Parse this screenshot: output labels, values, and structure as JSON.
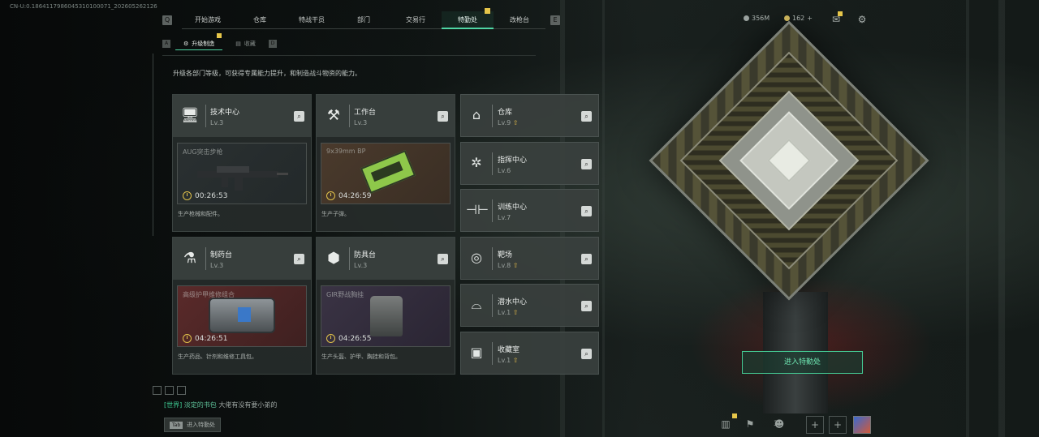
{
  "build_id": "CN-U:0.1864117986045310100071_202605262126",
  "nav": {
    "tabs": [
      "开始游戏",
      "仓库",
      "特战干员",
      "部门",
      "交易行",
      "特勤处",
      "改枪台"
    ],
    "active": "特勤处",
    "left_key": "Q",
    "right_key": "E"
  },
  "currency": {
    "primary": "356M",
    "secondary": "162"
  },
  "subtabs": [
    {
      "label": "升级制造",
      "active": true
    },
    {
      "label": "收藏",
      "active": false
    }
  ],
  "subtab_left_key": "A",
  "subtab_right_key": "D",
  "description": "升级各部门等级，可获得专属能力提升，和制造战斗物资的能力。",
  "production_stations": [
    {
      "name": "技术中心",
      "level": "Lv.3",
      "icon": "computer-icon",
      "item": "AUG突击步枪",
      "timer": "00:26:53",
      "footer": "生产枪械和配件。",
      "bg": "gray"
    },
    {
      "name": "工作台",
      "level": "Lv.3",
      "icon": "tools-icon",
      "item": "9x39mm BP",
      "timer": "04:26:59",
      "footer": "生产子弹。",
      "bg": "brown"
    },
    {
      "name": "制药台",
      "level": "Lv.3",
      "icon": "flask-icon",
      "item": "高级护甲维修组合",
      "timer": "04:26:51",
      "footer": "生产药品、针剂和维修工具包。",
      "bg": "red"
    },
    {
      "name": "防具台",
      "level": "Lv.3",
      "icon": "armor-icon",
      "item": "GIR野战胸挂",
      "timer": "04:26:55",
      "footer": "生产头盔、护甲、胸挂和背包。",
      "bg": "purple"
    }
  ],
  "departments": [
    {
      "name": "仓库",
      "level": "Lv.9",
      "icon": "warehouse-icon",
      "upgrade": true
    },
    {
      "name": "指挥中心",
      "level": "Lv.6",
      "icon": "chip-icon",
      "upgrade": false
    },
    {
      "name": "训练中心",
      "level": "Lv.7",
      "icon": "dumbbell-icon",
      "upgrade": false
    },
    {
      "name": "靶场",
      "level": "Lv.8",
      "icon": "target-icon",
      "upgrade": true
    },
    {
      "name": "潜水中心",
      "level": "Lv.1",
      "icon": "diving-icon",
      "upgrade": true
    },
    {
      "name": "收藏室",
      "level": "Lv.1",
      "icon": "collection-icon",
      "upgrade": true
    }
  ],
  "enter_button": "进入特勤处",
  "chat": {
    "channel": "[世界]",
    "user": "淡定的书包",
    "message": "大佬有没有要小弟的"
  },
  "tab_hint": {
    "key": "Tab",
    "label": "进入特勤处"
  },
  "party_count": "3",
  "colors": {
    "accent": "#4fd6a4",
    "badge": "#e6c64a"
  }
}
